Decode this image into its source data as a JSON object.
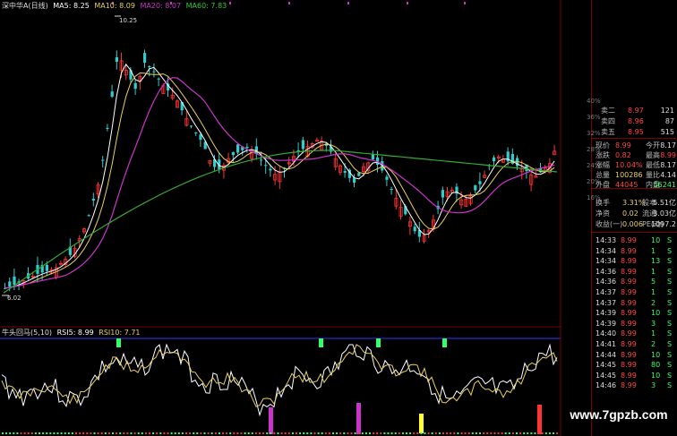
{
  "main_header": {
    "title": "深中华A(日线)",
    "ma5": "MA5: 8.25",
    "ma10": "MA10: 8.09",
    "ma20": "MA20: 8.07",
    "ma60": "MA60: 7.83"
  },
  "peak_label": "10.25",
  "low_label": "6.02",
  "sub_header": {
    "title": "牛头回马(5,10)",
    "rsi5": "RSI5: 8.99",
    "rsi10": "RSI10: 7.71"
  },
  "side_percent_labels": [
    "40%",
    "36%",
    "32%",
    "28%",
    "24%",
    "20%",
    "16%"
  ],
  "sell_rows": [
    {
      "label": "卖二",
      "price": "8.97",
      "vol": "121"
    },
    {
      "label": "卖四",
      "price": "8.96",
      "vol": "87"
    },
    {
      "label": "卖五",
      "price": "8.95",
      "vol": "515"
    }
  ],
  "quote_rows": [
    {
      "l1": "现价",
      "v1": "8.99",
      "l2": "今开",
      "v2": "8.17"
    },
    {
      "l1": "涨跌",
      "v1": "0.82",
      "l2": "最高",
      "v2": "8.99"
    },
    {
      "l1": "涨幅",
      "v1": "10.04%",
      "l2": "最低",
      "v2": "8.17"
    },
    {
      "l1": "总量",
      "v1": "100286",
      "l2": "量比",
      "v2": "4.14"
    },
    {
      "l1": "外盘",
      "v1": "44045",
      "l2": "内盘",
      "v2": "56241"
    }
  ],
  "stat_rows": [
    {
      "l1": "换手",
      "v1": "3.31%",
      "l2": "股本",
      "v2": "5.51亿"
    },
    {
      "l1": "净资",
      "v1": "0.02",
      "l2": "流通",
      "v2": "3.03亿"
    },
    {
      "l1": "收益(一)",
      "v1": "0.006",
      "l2": "PE(动)",
      "v2": "1097.2"
    }
  ],
  "ticks": [
    {
      "time": "14:33",
      "price": "8.99",
      "vol": "10",
      "side": "S"
    },
    {
      "time": "14:34",
      "price": "8.99",
      "vol": "1",
      "side": "S"
    },
    {
      "time": "14:34",
      "price": "8.99",
      "vol": "13",
      "side": "S"
    },
    {
      "time": "14:36",
      "price": "8.99",
      "vol": "1",
      "side": "S"
    },
    {
      "time": "14:36",
      "price": "8.99",
      "vol": "5",
      "side": "S"
    },
    {
      "time": "14:37",
      "price": "8.99",
      "vol": "1",
      "side": "S"
    },
    {
      "time": "14:37",
      "price": "8.99",
      "vol": "2",
      "side": "S"
    },
    {
      "time": "14:39",
      "price": "8.99",
      "vol": "10",
      "side": "S"
    },
    {
      "time": "14:39",
      "price": "8.99",
      "vol": "3",
      "side": "S"
    },
    {
      "time": "14:40",
      "price": "8.99",
      "vol": "1",
      "side": "S"
    },
    {
      "time": "14:41",
      "price": "8.99",
      "vol": "2",
      "side": "S"
    },
    {
      "time": "14:44",
      "price": "8.99",
      "vol": "10",
      "side": "S"
    },
    {
      "time": "14:45",
      "price": "8.99",
      "vol": "80",
      "side": "S"
    },
    {
      "time": "14:45",
      "price": "8.99",
      "vol": "10",
      "side": "S"
    },
    {
      "time": "14:46",
      "price": "8.99",
      "vol": "3",
      "side": "S"
    }
  ],
  "watermark": "www.7gpzb.com",
  "colors": {
    "up": "#ff3333",
    "down": "#33cccc",
    "ma5": "#ffffff",
    "ma10": "#e8d060",
    "ma20": "#cc33cc",
    "ma60": "#33aa33",
    "price_red": "#ff4444",
    "green": "#33ff66"
  }
}
